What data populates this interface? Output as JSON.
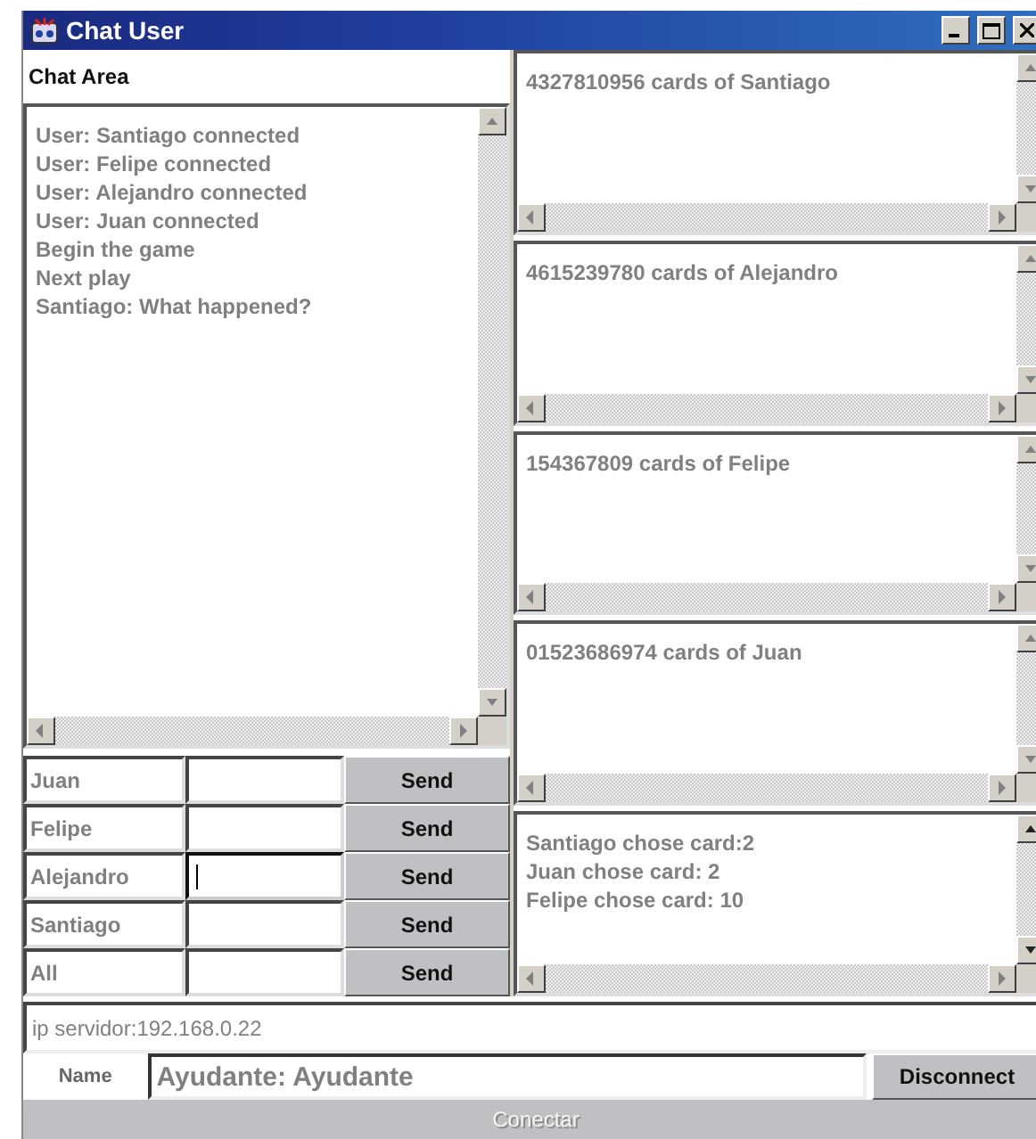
{
  "window": {
    "title": "Chat User"
  },
  "chat_area": {
    "label": "Chat Area",
    "lines": [
      "User: Santiago connected",
      "User: Felipe connected",
      "User: Alejandro connected",
      "User: Juan connected",
      "Begin the game",
      "Next play",
      "Santiago: What happened?"
    ]
  },
  "players": [
    {
      "name": "Juan",
      "focused": false,
      "button": "Send"
    },
    {
      "name": "Felipe",
      "focused": false,
      "button": "Send"
    },
    {
      "name": "Alejandro",
      "focused": true,
      "button": "Send"
    },
    {
      "name": "Santiago",
      "focused": false,
      "button": "Send"
    },
    {
      "name": "All",
      "focused": false,
      "button": "Send"
    }
  ],
  "card_panels": [
    {
      "text": "4327810956 cards of Santiago"
    },
    {
      "text": "4615239780 cards of Alejandro"
    },
    {
      "text": "154367809 cards of Felipe"
    },
    {
      "text": "01523686974 cards of Juan"
    }
  ],
  "game_log": {
    "lines": [
      "Santiago chose card:2",
      "Juan chose card: 2",
      "Felipe chose card: 10"
    ]
  },
  "server_field": {
    "value": "ip servidor:192.168.0.22"
  },
  "name_label": "Name",
  "name_field": {
    "value": "Ayudante: Ayudante"
  },
  "disconnect_button": {
    "label": "Disconnect",
    "disabled": false
  },
  "connect_button": {
    "label": "Conectar",
    "disabled": true
  }
}
